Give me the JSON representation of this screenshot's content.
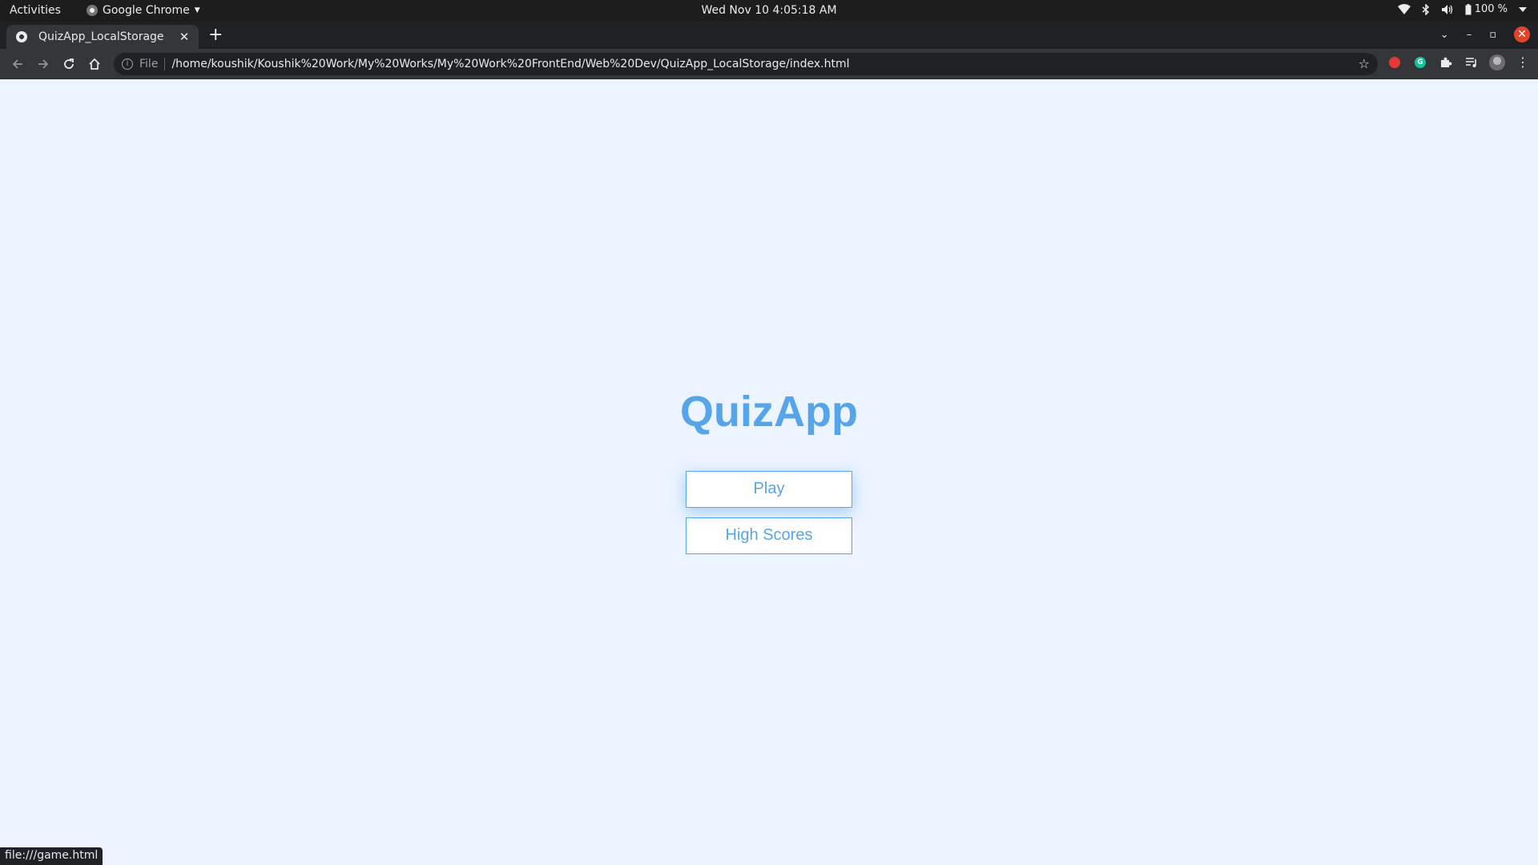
{
  "os": {
    "activities": "Activities",
    "app_name": "Google Chrome",
    "clock": "Wed Nov 10  4:05:18 AM",
    "battery": "100 %"
  },
  "browser": {
    "tab_title": "QuizApp_LocalStorage",
    "new_tab": "+",
    "url_scheme": "File",
    "url": "/home/koushik/Koushik%20Work/My%20Works/My%20Work%20FrontEnd/Web%20Dev/QuizApp_LocalStorage/index.html",
    "status_url": "file:///game.html"
  },
  "page": {
    "title": "QuizApp",
    "play_label": "Play",
    "highscores_label": "High Scores"
  },
  "colors": {
    "accent": "#56a5eb",
    "background": "#ecf4ff"
  }
}
